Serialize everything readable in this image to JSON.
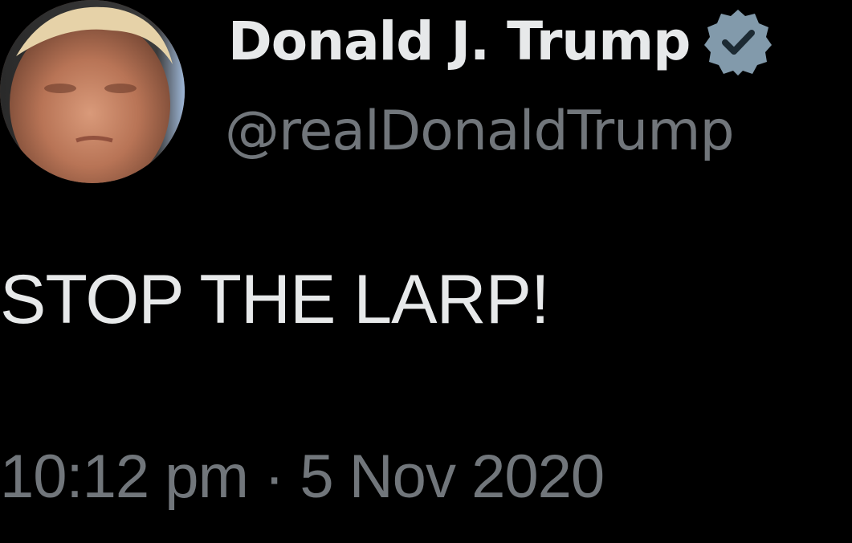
{
  "tweet": {
    "author": {
      "display_name": "Donald J. Trump",
      "handle": "@realDonaldTrump",
      "avatar_icon": "profile-photo",
      "verified_icon": "verified-badge-icon"
    },
    "text": "STOP THE LARP!",
    "timestamp": "10:12 pm · 5 Nov 2020"
  },
  "colors": {
    "background": "#000000",
    "primary_text": "#e7e9ea",
    "secondary_text": "#71767b",
    "verified_badge": "#829aab"
  }
}
